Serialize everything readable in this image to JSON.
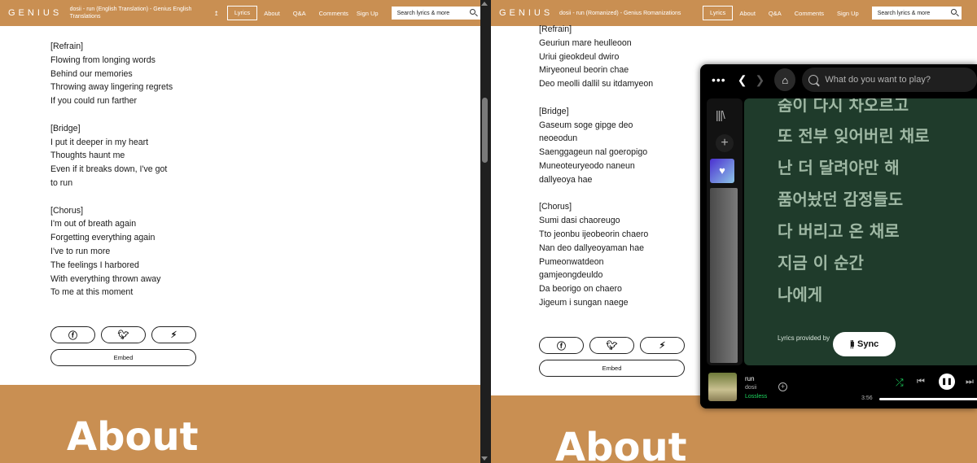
{
  "left": {
    "logo": "GENIUS",
    "title": "dosii - run (English Translation) - Genius English Translations",
    "nav": [
      "Lyrics",
      "About",
      "Q&A",
      "Comments",
      "Sign Up"
    ],
    "search_placeholder": "Search lyrics & more",
    "lyrics": [
      "[Refrain]",
      "Flowing from longing words",
      "Behind our memories",
      "Throwing away lingering regrets",
      "If you could run farther",
      "",
      "[Bridge]",
      "I put it deeper in my heart",
      "Thoughts haunt me",
      "Even if it breaks down, I've got",
      "to run",
      "",
      "[Chorus]",
      "I'm out of breath again",
      "Forgetting everything again",
      "I've to run more",
      "The feelings I harbored",
      "With everything thrown away",
      "To me at this moment"
    ],
    "share": {
      "facebook_icon": "f",
      "twitter_icon": "t",
      "genius_icon": "g"
    },
    "embed_label": "Embed",
    "about_title": "About"
  },
  "right": {
    "logo": "GENIUS",
    "title": "dosii - run (Romanized) - Genius Romanizations",
    "nav": [
      "Lyrics",
      "About",
      "Q&A",
      "Comments",
      "Sign Up"
    ],
    "search_placeholder": "Search lyrics & more",
    "lyrics": [
      "[Refrain]",
      "Geuriun mare heulleoon",
      "Uriui gieokdeul dwiro",
      "Miryeoneul beorin chae",
      "Deo meolli dallil su itdamyeon",
      "",
      "[Bridge]",
      "Gaseum soge gipge deo",
      "neoeodun",
      "Saenggageun nal goeropigo",
      "Muneoteuryeodo naneun",
      "dallyeoya hae",
      "",
      "[Chorus]",
      "Sumi dasi chaoreugo",
      "Tto jeonbu ijeobeorin chaero",
      "Nan deo dallyeoyaman hae",
      "Pumeonwatdeon",
      "gamjeongdeuldo",
      "Da beorigo on chaero",
      "Jigeum i sungan naege"
    ],
    "embed_label": "Embed",
    "about_title": "About"
  },
  "spotify": {
    "search_placeholder": "What do you want to play?",
    "korean_lyrics": [
      "숨이 다시 차오르고",
      "또 전부 잊어버린 채로",
      "난 더 달려야만 해",
      "품어놨던 감정들도",
      "다 버리고 온 채로",
      "지금 이 순간",
      "나에게"
    ],
    "lyrics_provided": "Lyrics provided by",
    "sync_label": "Sync",
    "track_name": "run",
    "track_artist": "dosii",
    "quality": "Lossless",
    "time": "3:56",
    "progress": 1.0,
    "accent": "#1ed760"
  },
  "colors": {
    "genius_header": "#c98f52",
    "lyrics_bg": "#1f3b2b"
  }
}
